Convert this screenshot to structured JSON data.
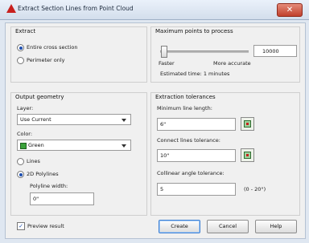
{
  "window": {
    "title": "Extract Section Lines from Point Cloud"
  },
  "extract": {
    "title": "Extract",
    "options": [
      "Entire cross section",
      "Perimeter only"
    ],
    "selected_index": 0
  },
  "max_points": {
    "title": "Maximum points to process",
    "value": "10000",
    "faster_label": "Faster",
    "more_accurate_label": "More accurate",
    "estimated_time": "Estimated time: 1 minutes"
  },
  "output": {
    "title": "Output geometry",
    "layer_label": "Layer:",
    "layer_value": "Use Current",
    "color_label": "Color:",
    "color_value": "Green",
    "color_swatch": "#3aa23a",
    "geometry_options": [
      "Lines",
      "2D Polylines"
    ],
    "geometry_selected_index": 1,
    "polyline_width_label": "Polyline width:",
    "polyline_width_value": "0\""
  },
  "tolerances": {
    "title": "Extraction tolerances",
    "min_line_length_label": "Minimum line length:",
    "min_line_length_value": "6\"",
    "connect_lines_label": "Connect lines tolerance:",
    "connect_lines_value": "10\"",
    "collinear_label": "Collinear angle tolerance:",
    "collinear_value": "5",
    "collinear_range": "(0 - 20°)"
  },
  "footer": {
    "preview_label": "Preview result",
    "preview_checked": true,
    "buttons": {
      "create": "Create",
      "cancel": "Cancel",
      "help": "Help"
    }
  }
}
